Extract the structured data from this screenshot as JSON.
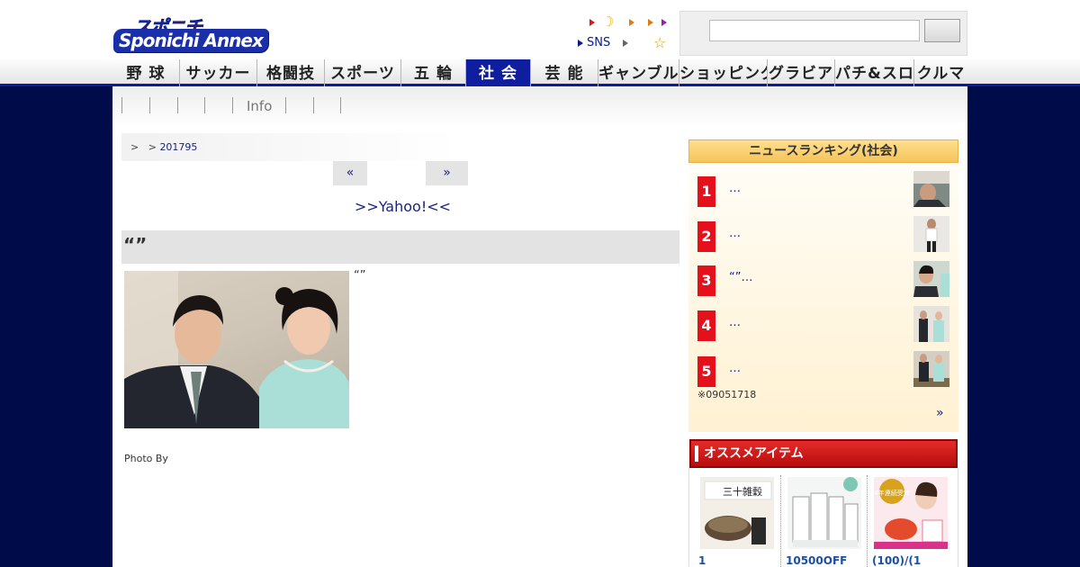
{
  "header": {
    "logo_top": "スポニチ",
    "logo_bottom": "Sponichi Annex",
    "sns_label": "SNS",
    "search": {
      "value": "",
      "placeholder": ""
    }
  },
  "nav": {
    "tabs": [
      {
        "label": "野 球"
      },
      {
        "label": "サッカー"
      },
      {
        "label": "格闘技"
      },
      {
        "label": "スポーツ"
      },
      {
        "label": "五 輪"
      },
      {
        "label": "社 会",
        "active": true
      },
      {
        "label": "芸 能"
      },
      {
        "label": "ギャンブル"
      },
      {
        "label": "ショッピング"
      },
      {
        "label": "グラビア"
      },
      {
        "label": "パチ&スロ"
      },
      {
        "label": "クルマ"
      }
    ]
  },
  "subnav": {
    "info_label": "Info"
  },
  "breadcrumb": {
    "sep1": ">",
    "sep2": ">",
    "date": "201795"
  },
  "pager": {
    "prev": "«",
    "next": "»"
  },
  "yahoo_link": ">>Yahoo!<<",
  "article": {
    "headline": "“”",
    "lead": "“”",
    "photo_credit": "Photo By"
  },
  "ranking": {
    "title": "ニュースランキング(社会)",
    "items": [
      {
        "rank": "1",
        "text": "…"
      },
      {
        "rank": "2",
        "text": "…"
      },
      {
        "rank": "3",
        "text": "“”…"
      },
      {
        "rank": "4",
        "text": "…"
      },
      {
        "rank": "5",
        "text": "…"
      }
    ],
    "note": "※09051718",
    "more": "»"
  },
  "recommend": {
    "title": "オススメアイテム",
    "items": [
      {
        "caption": "1"
      },
      {
        "caption": "10500OFF"
      },
      {
        "caption": "(100)/(1"
      }
    ],
    "item_labels": [
      "三十雑穀",
      "4年連続受賞"
    ]
  },
  "colors": {
    "accent": "#0f1e9e",
    "background": "#000c4a",
    "rank_badge": "#e4111c",
    "link": "#1a237e"
  }
}
